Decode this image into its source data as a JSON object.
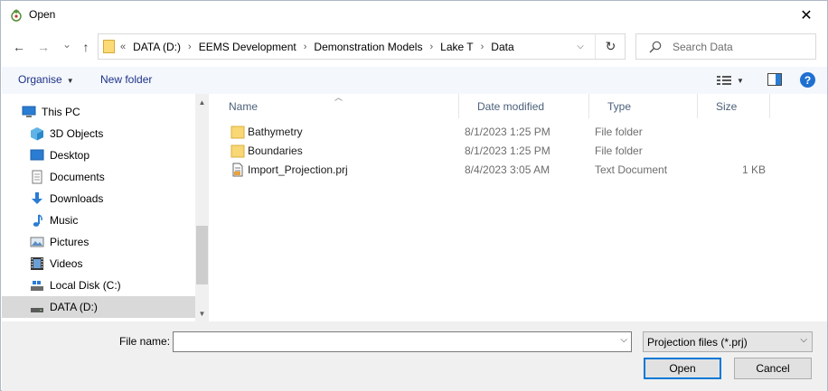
{
  "window": {
    "title": "Open"
  },
  "nav_buttons": {
    "back": "←",
    "forward": "→",
    "recent": "⌄",
    "up": "↑"
  },
  "address": {
    "lead": "«",
    "crumbs": [
      "DATA (D:)",
      "EEMS Development",
      "Demonstration Models",
      "Lake T",
      "Data"
    ],
    "separator": "›"
  },
  "search": {
    "placeholder": "Search Data"
  },
  "toolbar": {
    "organise": "Organise",
    "new_folder": "New folder"
  },
  "navpane": {
    "items": [
      {
        "label": "This PC",
        "icon": "pc-icon"
      },
      {
        "label": "3D Objects",
        "icon": "3d-objects-icon"
      },
      {
        "label": "Desktop",
        "icon": "desktop-icon"
      },
      {
        "label": "Documents",
        "icon": "documents-icon"
      },
      {
        "label": "Downloads",
        "icon": "downloads-icon"
      },
      {
        "label": "Music",
        "icon": "music-icon"
      },
      {
        "label": "Pictures",
        "icon": "pictures-icon"
      },
      {
        "label": "Videos",
        "icon": "videos-icon"
      },
      {
        "label": "Local Disk (C:)",
        "icon": "drive-icon"
      },
      {
        "label": "DATA (D:)",
        "icon": "drive-icon",
        "selected": true
      }
    ]
  },
  "columns": {
    "name": "Name",
    "date": "Date modified",
    "type": "Type",
    "size": "Size"
  },
  "files": [
    {
      "name": "Bathymetry",
      "date": "8/1/2023 1:25 PM",
      "type": "File folder",
      "size": "",
      "icon": "folder-icon"
    },
    {
      "name": "Boundaries",
      "date": "8/1/2023 1:25 PM",
      "type": "File folder",
      "size": "",
      "icon": "folder-icon"
    },
    {
      "name": "Import_Projection.prj",
      "date": "8/4/2023 3:05 AM",
      "type": "Text Document",
      "size": "1 KB",
      "icon": "text-file-icon"
    }
  ],
  "footer": {
    "file_name_label": "File name:",
    "file_name_value": "",
    "file_type": "Projection files (*.prj)",
    "open": "Open",
    "cancel": "Cancel"
  },
  "colors": {
    "accent": "#0078d7",
    "link": "#1e3287",
    "folder": "#f8d775",
    "selected": "#d9d9d9"
  }
}
